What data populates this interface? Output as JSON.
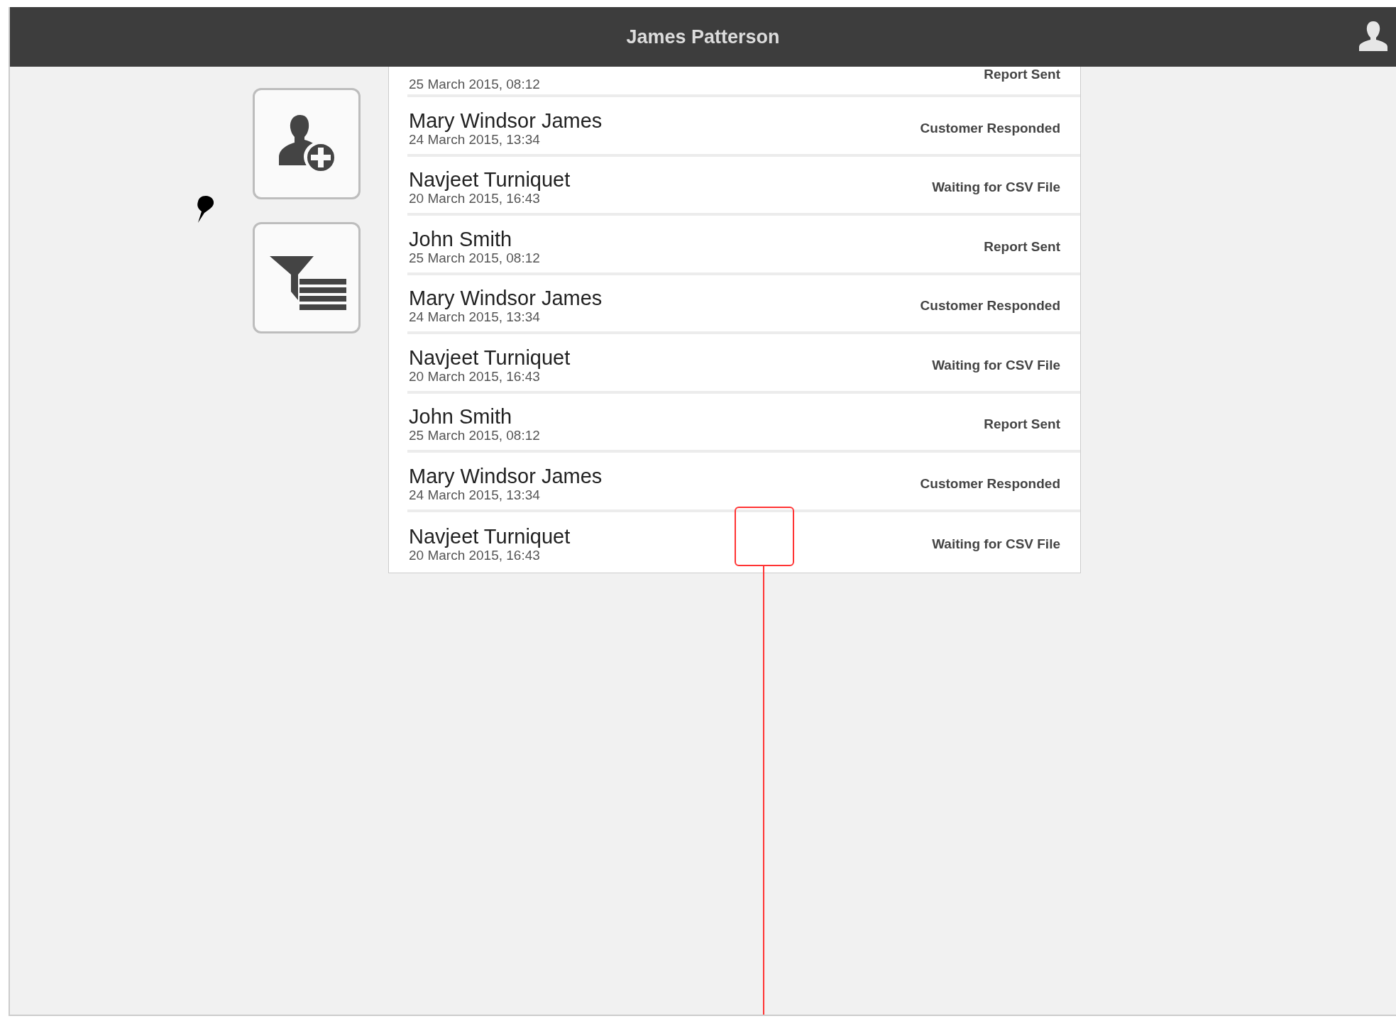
{
  "header": {
    "title": "James Patterson"
  },
  "tool_buttons": [
    {
      "kind": "add-user"
    },
    {
      "kind": "filter-list"
    }
  ],
  "records": [
    {
      "date": "25 March 2015, 08:12",
      "status": "Report Sent"
    },
    {
      "name": "Mary Windsor James",
      "date": "24 March 2015, 13:34",
      "status": "Customer Responded"
    },
    {
      "name": "Navjeet Turniquet",
      "date": "20 March 2015, 16:43",
      "status": "Waiting for CSV File"
    },
    {
      "name": "John Smith",
      "date": "25 March 2015, 08:12",
      "status": "Report Sent"
    },
    {
      "name": "Mary Windsor James",
      "date": "24 March 2015, 13:34",
      "status": "Customer Responded"
    },
    {
      "name": "Navjeet Turniquet",
      "date": "20 March 2015, 16:43",
      "status": "Waiting for CSV File"
    },
    {
      "name": "John Smith",
      "date": "25 March 2015, 08:12",
      "status": "Report Sent"
    },
    {
      "name": "Mary Windsor James",
      "date": "24 March 2015, 13:34",
      "status": "Customer Responded"
    },
    {
      "name": "Navjeet Turniquet",
      "date": "20 March 2015, 16:43",
      "status": "Waiting for CSV File"
    }
  ]
}
